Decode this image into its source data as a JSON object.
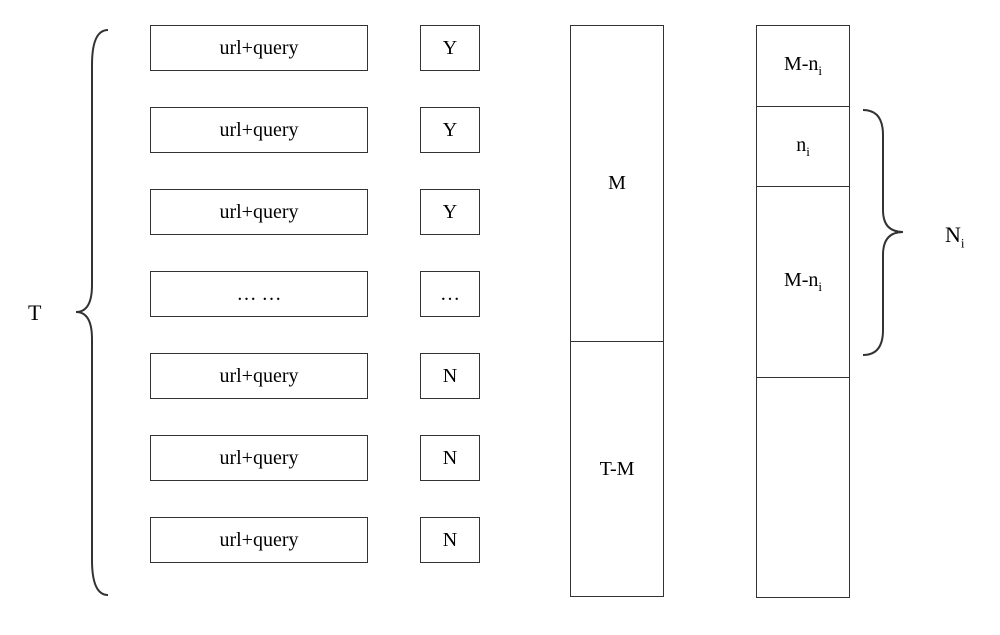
{
  "labels": {
    "T": "T",
    "Ni": "N",
    "Ni_sub": "i"
  },
  "col1": [
    "url+query",
    "url+query",
    "url+query",
    "… …",
    "url+query",
    "url+query",
    "url+query"
  ],
  "col2": [
    "Y",
    "Y",
    "Y",
    "…",
    "N",
    "N",
    "N"
  ],
  "col3": [
    "M",
    "T-M"
  ],
  "col4": {
    "b1": "M-n",
    "b1_sub": "i",
    "b2": "n",
    "b2_sub": "i",
    "b3": "M-n",
    "b3_sub": "i",
    "b4": ""
  }
}
